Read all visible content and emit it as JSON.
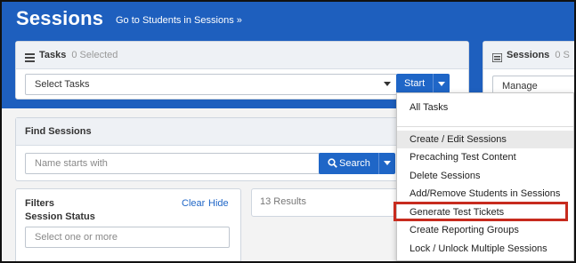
{
  "header": {
    "title": "Sessions",
    "link": "Go to Students in Sessions »"
  },
  "tasks_panel": {
    "title": "Tasks",
    "selected_count": "0 Selected",
    "select_placeholder": "Select Tasks",
    "start_label": "Start"
  },
  "sessions_panel": {
    "title": "Sessions",
    "selected_count": "0 S",
    "select_value": "Manage"
  },
  "find_sessions": {
    "title": "Find Sessions",
    "search_placeholder": "Name starts with",
    "search_label": "Search"
  },
  "filters": {
    "title": "Filters",
    "clear": "Clear",
    "hide": "Hide",
    "status_label": "Session Status",
    "status_placeholder": "Select one or more"
  },
  "results": {
    "count_text": "13 Results"
  },
  "dropdown": {
    "items": [
      "All Tasks",
      "Create / Edit Sessions",
      "Precaching Test Content",
      "Delete Sessions",
      "Add/Remove Students in Sessions",
      "Generate Test Tickets",
      "Create Reporting Groups",
      "Lock / Unlock Multiple Sessions"
    ],
    "highlighted": "Generate Test Tickets"
  },
  "colors": {
    "brand_blue": "#1e5fbe",
    "button_blue": "#1f66c7",
    "highlight_red": "#c72b1e"
  },
  "icons": {
    "tasks_icon": "list-icon",
    "sessions_icon": "list-icon",
    "search_icon": "search-icon"
  }
}
